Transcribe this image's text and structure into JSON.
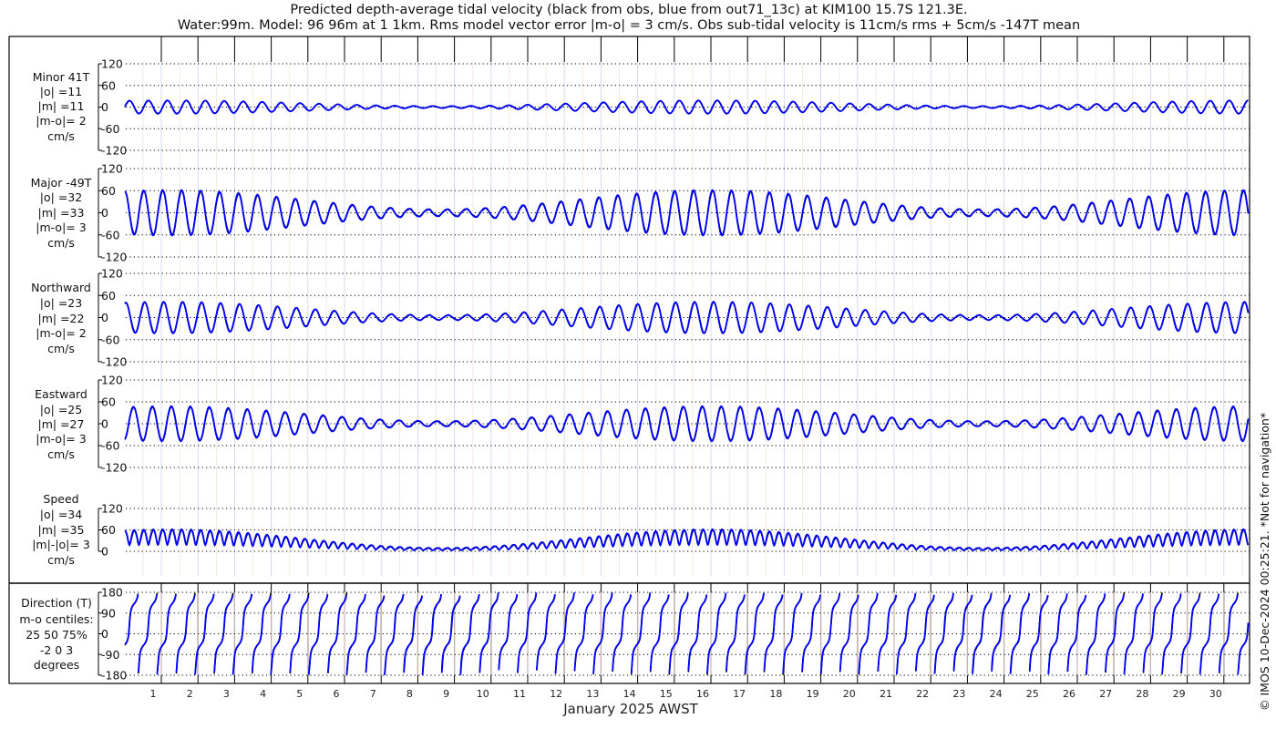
{
  "chart_data": {
    "type": "line",
    "title": [
      "Predicted depth-average tidal velocity (black from obs, blue from out71_13c) at KIM100 15.7S 121.3E.",
      "Water:99m. Model: 96 96m at 1 1km. Rms model vector error |m-o| = 3 cm/s. Obs sub-tidal velocity is 11cm/s rms + 5cm/s -147T mean"
    ],
    "xlabel": "January 2025 AWST",
    "x_tick_labels": [
      "1",
      "2",
      "3",
      "4",
      "5",
      "6",
      "7",
      "8",
      "9",
      "10",
      "11",
      "12",
      "13",
      "14",
      "15",
      "16",
      "17",
      "18",
      "19",
      "20",
      "21",
      "22",
      "23",
      "24",
      "25",
      "26",
      "27",
      "28",
      "29",
      "30"
    ],
    "xlim_days": [
      0,
      30.66
    ],
    "credit": "© IMOS 10-Dec-2024 00:25:21. *Not for navigation*",
    "series_colors": {
      "obs": "#000000",
      "model": "#0000ff"
    },
    "signal": {
      "semidiurnal_period_days": 0.5175,
      "spring_neap_period_days": 14.8,
      "spring_peak_day": 16.0,
      "neap_fraction": 0.15,
      "major_axis_deg_true": -49,
      "major_amplitude_cms": 60,
      "minor_amplitude_cms": 20
    },
    "panels": [
      {
        "key": "minor",
        "labels": [
          "Minor 41T",
          "|o| =11",
          "|m| =11",
          "|m-o|= 2",
          "cm/s"
        ],
        "ylim": [
          -120,
          120
        ],
        "yticks": [
          120,
          60,
          0,
          -60,
          -120
        ]
      },
      {
        "key": "major",
        "labels": [
          "Major -49T",
          "|o| =32",
          "|m| =33",
          "|m-o|= 3",
          "cm/s"
        ],
        "ylim": [
          -120,
          120
        ],
        "yticks": [
          120,
          60,
          0,
          -60,
          -120
        ]
      },
      {
        "key": "north",
        "labels": [
          "Northward",
          "|o| =23",
          "|m| =22",
          "|m-o|= 2",
          "cm/s"
        ],
        "ylim": [
          -120,
          120
        ],
        "yticks": [
          120,
          60,
          0,
          -60,
          -120
        ]
      },
      {
        "key": "east",
        "labels": [
          "Eastward",
          "|o| =25",
          "|m| =27",
          "|m-o|= 3",
          "cm/s"
        ],
        "ylim": [
          -120,
          120
        ],
        "yticks": [
          120,
          60,
          0,
          -60,
          -120
        ]
      },
      {
        "key": "speed",
        "labels": [
          "Speed",
          "|o| =34",
          "|m| =35",
          "|m|-|o|= 3",
          "cm/s"
        ],
        "ylim": [
          0,
          120
        ],
        "yticks": [
          120,
          60,
          0
        ]
      },
      {
        "key": "dir",
        "labels": [
          "Direction (T)",
          "m-o centiles:",
          "25  50  75%",
          "-2  0  3",
          "degrees"
        ],
        "ylim": [
          -180,
          180
        ],
        "yticks": [
          180,
          90,
          0,
          -90,
          -180
        ]
      }
    ]
  }
}
